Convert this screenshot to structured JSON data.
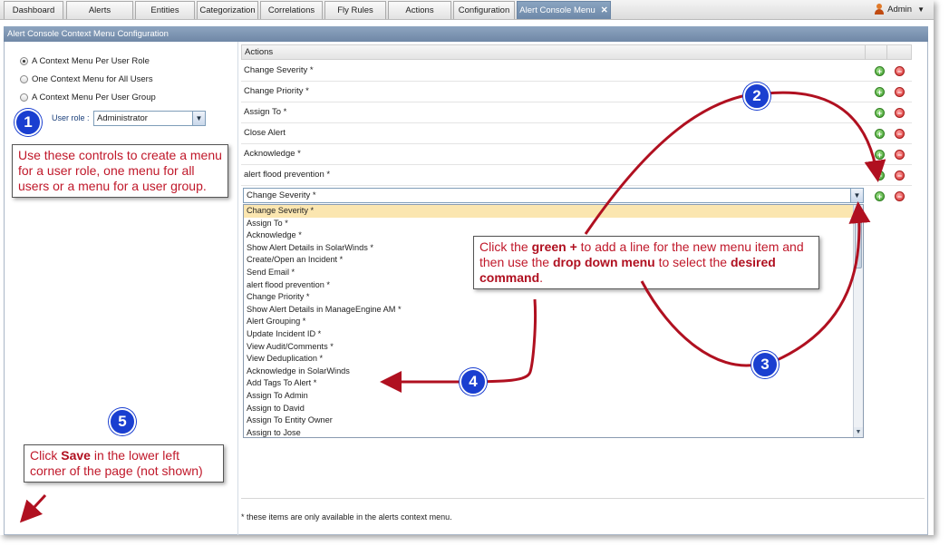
{
  "tabs": [
    {
      "label": "Dashboard"
    },
    {
      "label": "Alerts"
    },
    {
      "label": "Entities"
    },
    {
      "label": "Categorization"
    },
    {
      "label": "Correlations"
    },
    {
      "label": "Fly Rules"
    },
    {
      "label": "Actions"
    },
    {
      "label": "Configuration"
    },
    {
      "label": "Alert Console Menu",
      "close": "✕"
    }
  ],
  "user": {
    "label": "Admin"
  },
  "panel": {
    "title": "Alert Console Context Menu Configuration"
  },
  "options": [
    {
      "label": "A Context Menu Per User Role",
      "selected": true
    },
    {
      "label": "One Context Menu for All Users",
      "selected": false
    },
    {
      "label": "A Context Menu Per User Group",
      "selected": false
    }
  ],
  "user_role": {
    "label": "User role :",
    "value": "Administrator"
  },
  "actions": {
    "header": "Actions",
    "rows": [
      "Change Severity *",
      "Change Priority *",
      "Assign To *",
      "Close Alert",
      "Acknowledge *",
      "alert flood prevention *"
    ],
    "new_row_value": "Change Severity *"
  },
  "dropdown_options": [
    "Change Severity *",
    "Assign To *",
    "Acknowledge *",
    "Show Alert Details in SolarWinds *",
    "Create/Open an Incident *",
    "Send Email *",
    "alert flood prevention *",
    "Change Priority *",
    "Show Alert Details in ManageEngine AM *",
    "Alert Grouping *",
    "Update Incident ID *",
    "View Audit/Comments *",
    "View Deduplication *",
    "Acknowledge in SolarWinds",
    "Add Tags To Alert *",
    "Assign To Admin",
    "Assign to David",
    "Assign To Entity Owner",
    "Assign to Jose"
  ],
  "footnote": "* these items are only available in the alerts context menu.",
  "callouts": {
    "c1": "Use these controls to create a menu for a user role, one menu for all users or a menu for a user group.",
    "c2_pre": "Click the ",
    "c2_b1": "green +",
    "c2_mid1": " to add a line for the new menu item and then use the ",
    "c2_b2": "drop down menu",
    "c2_mid2": " to select the ",
    "c2_b3": "desired command",
    "c2_end": ".",
    "c5_pre": "Click ",
    "c5_b": "Save",
    "c5_end": " in the lower left corner of the page (not shown)"
  },
  "badges": [
    "1",
    "2",
    "3",
    "4",
    "5"
  ],
  "colors": {
    "accent": "#c0182a",
    "badge": "#1a3fd0",
    "header": "#6f87a6"
  }
}
